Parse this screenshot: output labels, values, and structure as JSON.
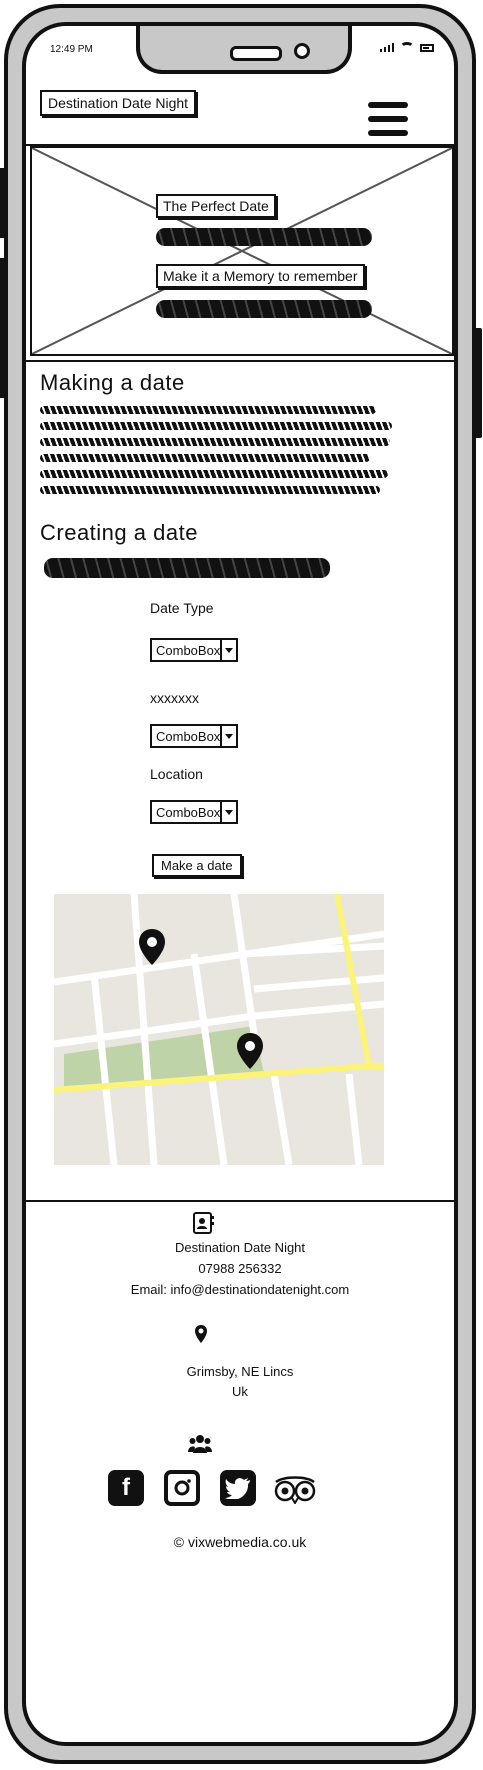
{
  "status_bar": {
    "time": "12:49 PM"
  },
  "header": {
    "brand": "Destination Date Night"
  },
  "hero": {
    "label_1": "The Perfect Date",
    "label_2": "Make it a Memory to remember"
  },
  "sections": {
    "making_title": "Making a date",
    "creating_title": "Creating a date"
  },
  "form": {
    "date_type_label": "Date Type",
    "date_type_value": "ComboBox",
    "second_label": "xxxxxxx",
    "second_value": "ComboBox",
    "location_label": "Location",
    "location_value": "ComboBox",
    "submit_label": "Make a date"
  },
  "footer": {
    "company": "Destination Date Night",
    "phone": "07988 256332",
    "email": "Email: info@destinationdatenight.com",
    "city": "Grimsby, NE Lincs",
    "country": "Uk",
    "copyright": "© vixwebmedia.co.uk",
    "icons": [
      "contact-card-icon",
      "location-pin-icon",
      "group-icon",
      "facebook-icon",
      "instagram-icon",
      "twitter-icon",
      "tripadvisor-icon"
    ]
  },
  "colors": {
    "map_bg": "#e9e6df",
    "map_park": "#bfd3a8",
    "map_road_major": "#fbf37a",
    "outline": "#111111"
  }
}
